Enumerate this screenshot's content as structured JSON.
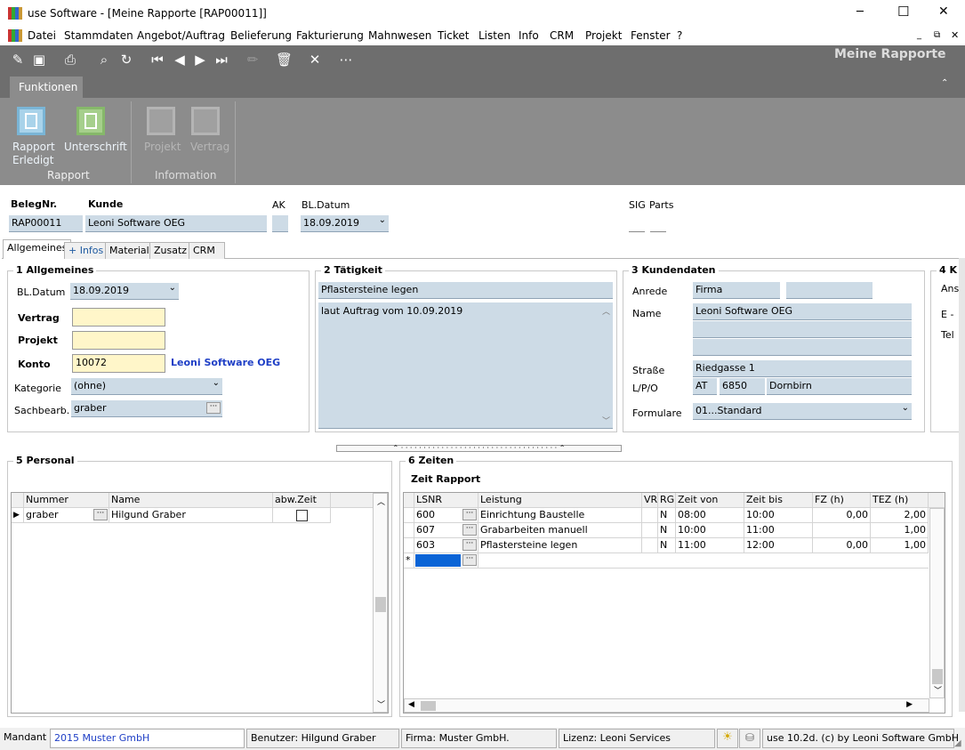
{
  "window": {
    "title": "use Software - [Meine Rapporte [RAP00011]]",
    "minimize": "─",
    "maximize": "☐",
    "close": "✕"
  },
  "menu": [
    "Datei",
    "Stammdaten",
    "Angebot/Auftrag",
    "Belieferung",
    "Fakturierung",
    "Mahnwesen",
    "Ticket",
    "Listen",
    "Info",
    "CRM",
    "Projekt",
    "Fenster",
    "?"
  ],
  "toolbar": {
    "caption": "Meine Rapporte"
  },
  "ribbon": {
    "tab": "Funktionen",
    "groups": [
      {
        "label": "Rapport",
        "buttons": [
          {
            "label1": "Rapport",
            "label2": "Erledigt"
          },
          {
            "label1": "Unterschrift",
            "label2": ""
          }
        ]
      },
      {
        "label": "Information",
        "buttons": [
          {
            "label1": "Projekt",
            "label2": ""
          },
          {
            "label1": "Vertrag",
            "label2": ""
          }
        ]
      }
    ]
  },
  "header": {
    "belegnr_label": "BelegNr.",
    "belegnr": "RAP00011",
    "kunde_label": "Kunde",
    "kunde": "Leoni Software OEG",
    "ak_label": "AK",
    "datum_label": "BL.Datum",
    "datum": "18.09.2019",
    "sig_label": "SIG",
    "parts_label": "Parts"
  },
  "tabs": [
    "Allgemeines",
    "+ Infos",
    "Material",
    "Zusatz",
    "CRM"
  ],
  "allgemeines": {
    "title": "1 Allgemeines",
    "datum_label": "BL.Datum",
    "datum": "18.09.2019",
    "vertrag_label": "Vertrag",
    "vertrag": "",
    "projekt_label": "Projekt",
    "projekt": "",
    "konto_label": "Konto",
    "konto": "10072",
    "konto_name": "Leoni Software OEG",
    "kategorie_label": "Kategorie",
    "kategorie": "(ohne)",
    "sachbearb_label": "Sachbearb.",
    "sachbearb": "graber"
  },
  "taetigkeit": {
    "title": "2 Tätigkeit",
    "kurz": "Pflastersteine legen",
    "text": "laut Auftrag vom 10.09.2019"
  },
  "kundendaten": {
    "title": "3 Kundendaten",
    "anrede_label": "Anrede",
    "anrede": "Firma",
    "name_label": "Name",
    "name": "Leoni Software OEG",
    "strasse_label": "Straße",
    "strasse": "Riedgasse 1",
    "lpo_label": "L/P/O",
    "land": "AT",
    "plz": "6850",
    "ort": "Dornbirn",
    "formulare_label": "Formulare",
    "formulare": "01...Standard"
  },
  "section4": {
    "title": "4 K",
    "l1": "Ans",
    "l2": "E -",
    "l3": "Tel"
  },
  "personal": {
    "title": "5 Personal",
    "columns": [
      "Nummer",
      "Name",
      "abw.Zeit"
    ],
    "rows": [
      {
        "nummer": "graber",
        "name": "Hilgund Graber"
      }
    ]
  },
  "zeiten": {
    "title": "6 Zeiten",
    "subtitle": "Zeit Rapport",
    "columns": [
      "LSNR",
      "Leistung",
      "VR",
      "RG",
      "Zeit von",
      "Zeit bis",
      "FZ (h)",
      "TEZ (h)"
    ],
    "rows": [
      {
        "lsnr": "600",
        "leistung": "Einrichtung Baustelle",
        "vr": "",
        "rg": "N",
        "von": "08:00",
        "bis": "10:00",
        "fz": "0,00",
        "tez": "2,00"
      },
      {
        "lsnr": "607",
        "leistung": "Grabarbeiten manuell",
        "vr": "",
        "rg": "N",
        "von": "10:00",
        "bis": "11:00",
        "fz": "",
        "tez": "1,00"
      },
      {
        "lsnr": "603",
        "leistung": "Pflastersteine legen",
        "vr": "",
        "rg": "N",
        "von": "11:00",
        "bis": "12:00",
        "fz": "0,00",
        "tez": "1,00"
      }
    ]
  },
  "status": {
    "mandant_label": "Mandant",
    "mandant": "2015 Muster GmbH",
    "user": "Benutzer: Hilgund Graber",
    "firma": "Firma: Muster GmbH.",
    "lizenz": "Lizenz: Leoni Services",
    "version": "use 10.2d. (c) by Leoni Software GmbH"
  }
}
